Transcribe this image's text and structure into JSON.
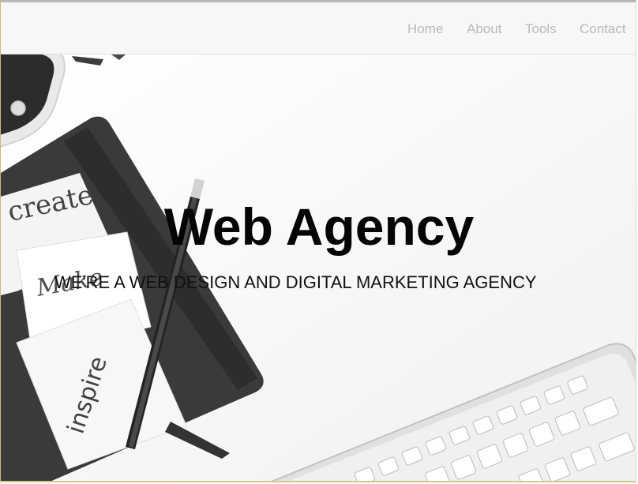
{
  "nav": {
    "items": [
      {
        "label": "Home"
      },
      {
        "label": "About"
      },
      {
        "label": "Tools"
      },
      {
        "label": "Contact"
      }
    ]
  },
  "hero": {
    "title": "Web Agency",
    "subtitle": "WE'RE A WEB DESIGN AND DIGITAL MARKETING AGENCY",
    "notebook_words": [
      "create",
      "Make",
      "inspire"
    ]
  },
  "colors": {
    "nav_background": "#f7f7f7",
    "nav_text": "#b9b9b9",
    "title_text": "#050505",
    "notebook": "#2a2a2a",
    "keyboard": "#d9d9d9"
  }
}
